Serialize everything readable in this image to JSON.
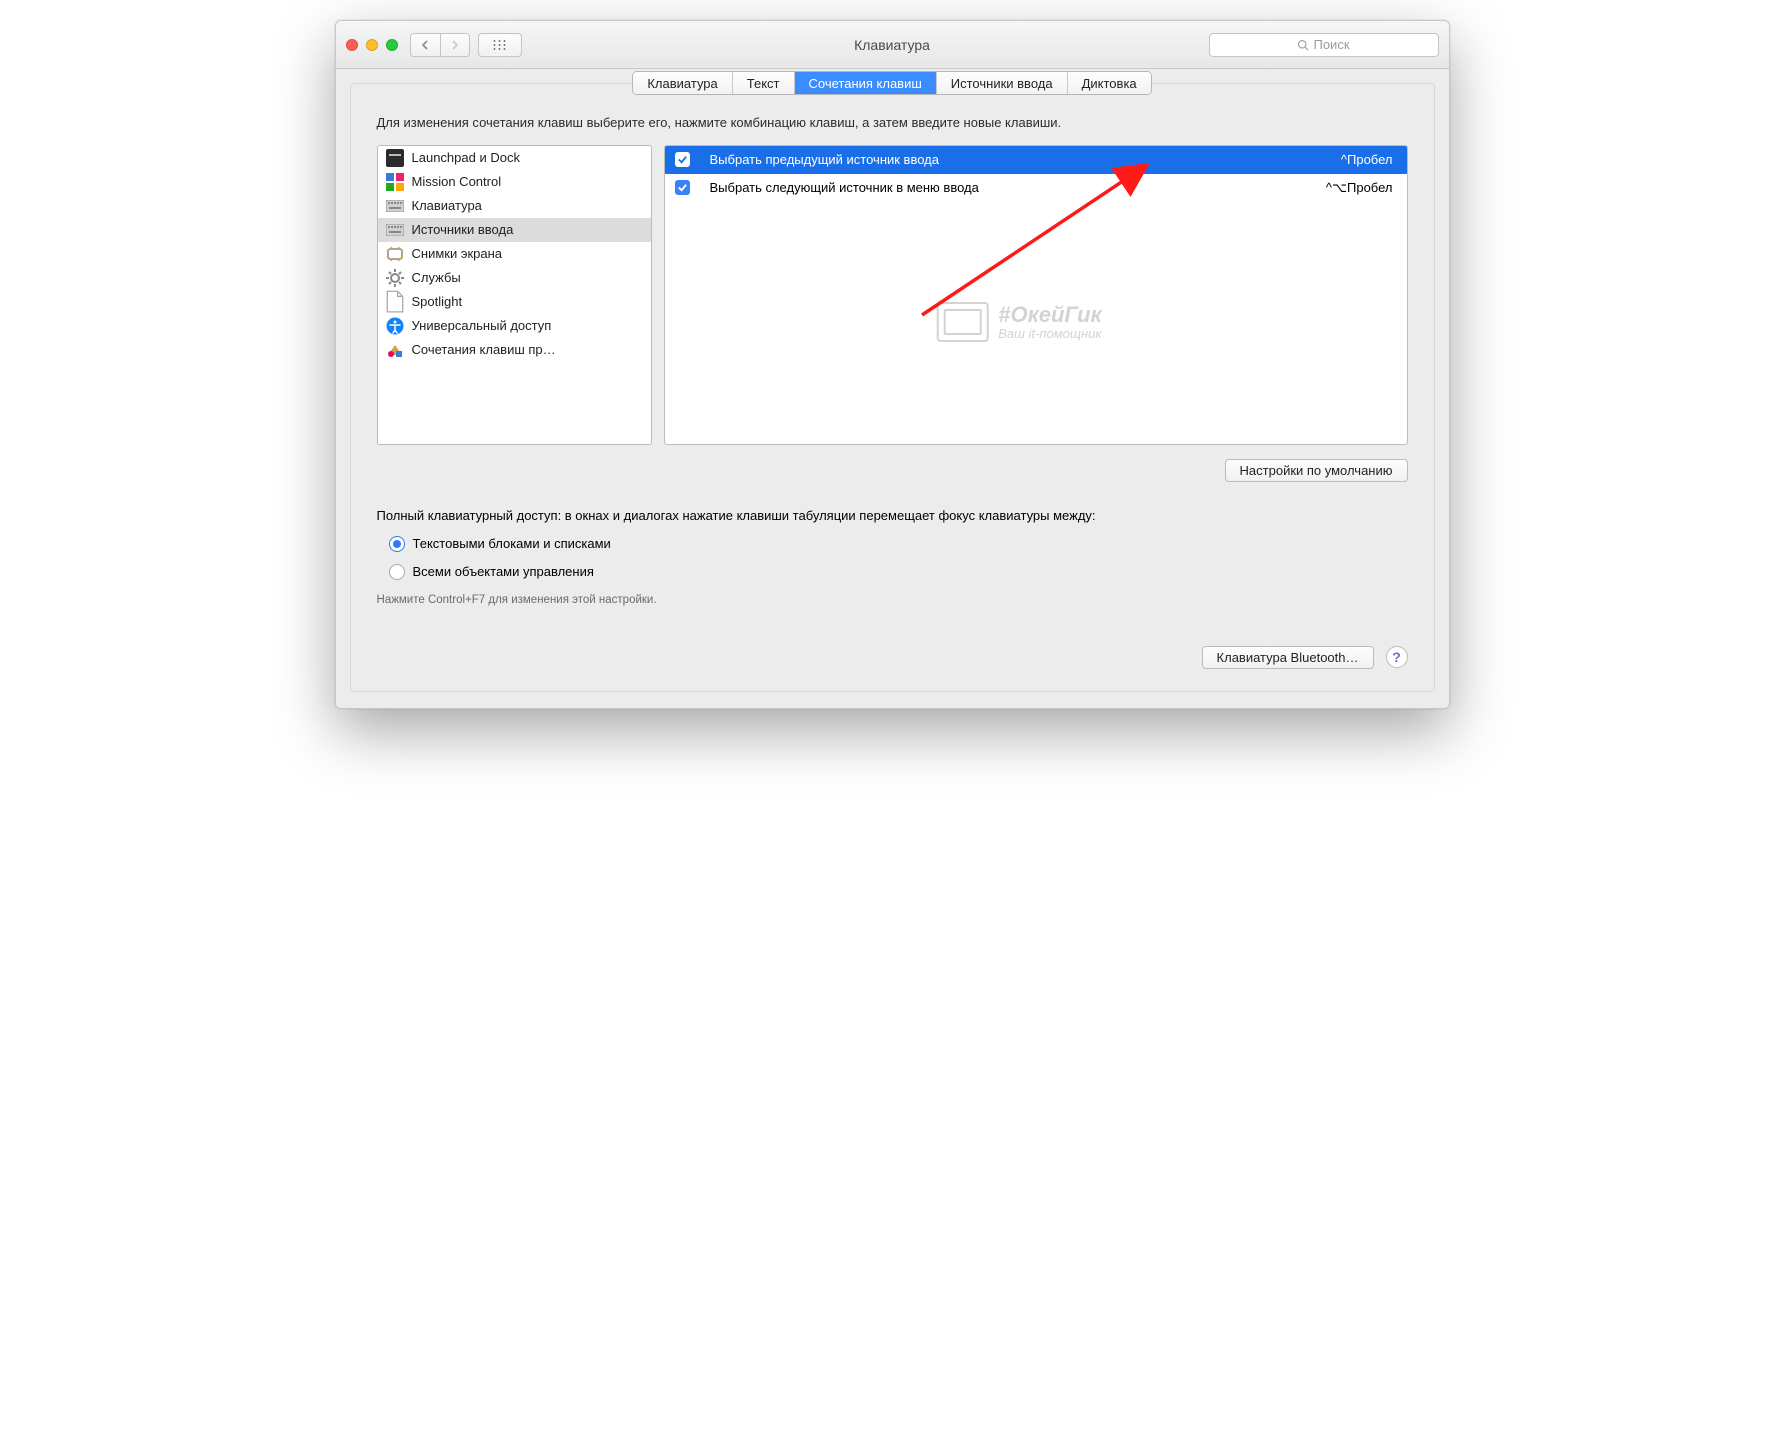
{
  "window": {
    "title": "Клавиатура"
  },
  "search": {
    "placeholder": "Поиск"
  },
  "tabs": [
    {
      "label": "Клавиатура",
      "active": false
    },
    {
      "label": "Текст",
      "active": false
    },
    {
      "label": "Сочетания клавиш",
      "active": true
    },
    {
      "label": "Источники ввода",
      "active": false
    },
    {
      "label": "Диктовка",
      "active": false
    }
  ],
  "instructions": "Для изменения сочетания клавиш выберите его, нажмите комбинацию клавиш, а затем введите новые клавиши.",
  "categories": [
    {
      "label": "Launchpad и Dock",
      "icon": "launchpad",
      "selected": false
    },
    {
      "label": "Mission Control",
      "icon": "mission",
      "selected": false
    },
    {
      "label": "Клавиатура",
      "icon": "keyboard",
      "selected": false
    },
    {
      "label": "Источники ввода",
      "icon": "keyboard",
      "selected": true
    },
    {
      "label": "Снимки экрана",
      "icon": "screenshot",
      "selected": false
    },
    {
      "label": "Службы",
      "icon": "gear",
      "selected": false
    },
    {
      "label": "Spotlight",
      "icon": "doc",
      "selected": false
    },
    {
      "label": "Универсальный доступ",
      "icon": "accessibility",
      "selected": false
    },
    {
      "label": "Сочетания клавиш пр…",
      "icon": "apps",
      "selected": false
    }
  ],
  "shortcuts": [
    {
      "checked": true,
      "label": "Выбрать предыдущий источник ввода",
      "shortcut": "^Пробел",
      "selected": true
    },
    {
      "checked": true,
      "label": "Выбрать следующий источник в меню ввода",
      "shortcut": "^⌥Пробел",
      "selected": false
    }
  ],
  "watermark": {
    "line1": "#ОкейГик",
    "line2": "Ваш it-помощник"
  },
  "buttons": {
    "restore_defaults": "Настройки по умолчанию",
    "bluetooth": "Клавиатура Bluetooth…"
  },
  "full_keyboard_access": {
    "heading": "Полный клавиатурный доступ: в окнах и диалогах нажатие клавиши табуляции перемещает фокус клавиатуры между:",
    "options": [
      {
        "label": "Текстовыми блоками и списками",
        "checked": true
      },
      {
        "label": "Всеми объектами управления",
        "checked": false
      }
    ],
    "footnote": "Нажмите Control+F7 для изменения этой настройки."
  },
  "help_label": "?"
}
